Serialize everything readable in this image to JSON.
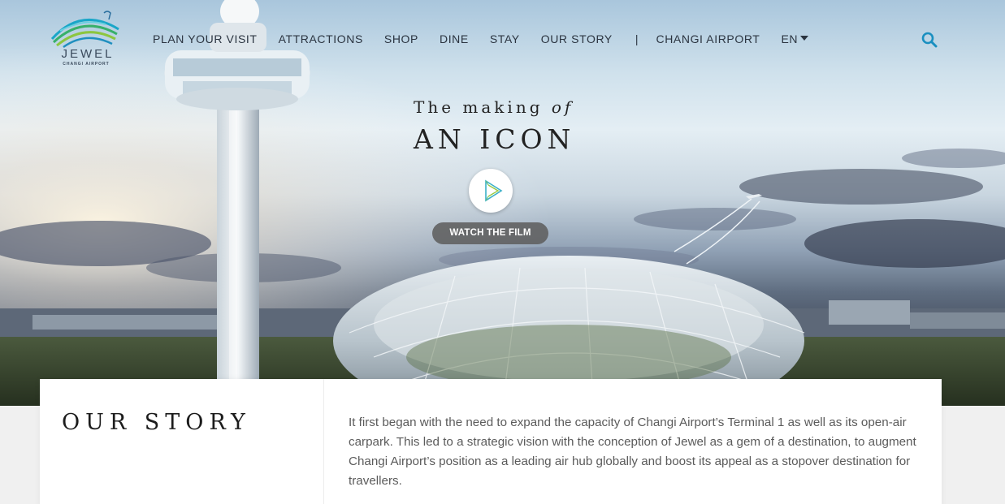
{
  "header": {
    "logo": {
      "wordmark": "JEWEL",
      "subtitle": "CHANGI AIRPORT",
      "icon": "jewel-logo-icon"
    },
    "nav": [
      {
        "label": "PLAN YOUR VISIT"
      },
      {
        "label": "ATTRACTIONS"
      },
      {
        "label": "SHOP"
      },
      {
        "label": "DINE"
      },
      {
        "label": "STAY"
      },
      {
        "label": "OUR STORY"
      }
    ],
    "separator": "|",
    "external_link": "CHANGI AIRPORT",
    "language": "EN",
    "search_icon": "search-icon"
  },
  "hero": {
    "title_prefix": "The making",
    "title_of": "of",
    "title_main": "AN ICON",
    "play_icon": "play-icon",
    "watch_label": "WATCH THE FILM"
  },
  "story": {
    "title": "OUR STORY",
    "body": "It first began with the need to expand the capacity of Changi Airport’s Terminal 1 as well as its open-air carpark. This led to a strategic vision with the conception of Jewel as a gem of a destination, to augment Changi Airport’s position as a leading air hub globally and boost its appeal as a stopover destination for travellers."
  },
  "colors": {
    "accent": "#1a8fc0",
    "text_dark": "#2b3440",
    "button_bg": "#5f5f5f"
  }
}
